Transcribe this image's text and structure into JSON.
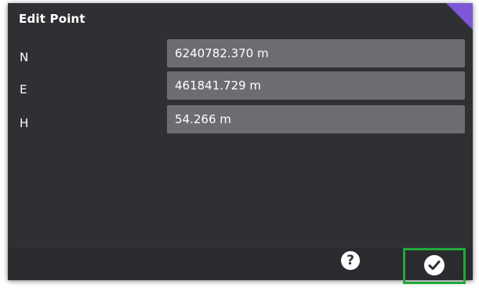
{
  "dialog": {
    "title": "Edit Point",
    "accent_color": "#7e57d6"
  },
  "fields": [
    {
      "label": "N",
      "value": "6240782.370 m"
    },
    {
      "label": "E",
      "value": "461841.729 m"
    },
    {
      "label": "H",
      "value": "54.266 m"
    }
  ],
  "footer": {
    "help_glyph": "?",
    "help_icon": "help-icon",
    "confirm_icon": "checkmark-icon",
    "highlight_color": "#22a83a"
  }
}
